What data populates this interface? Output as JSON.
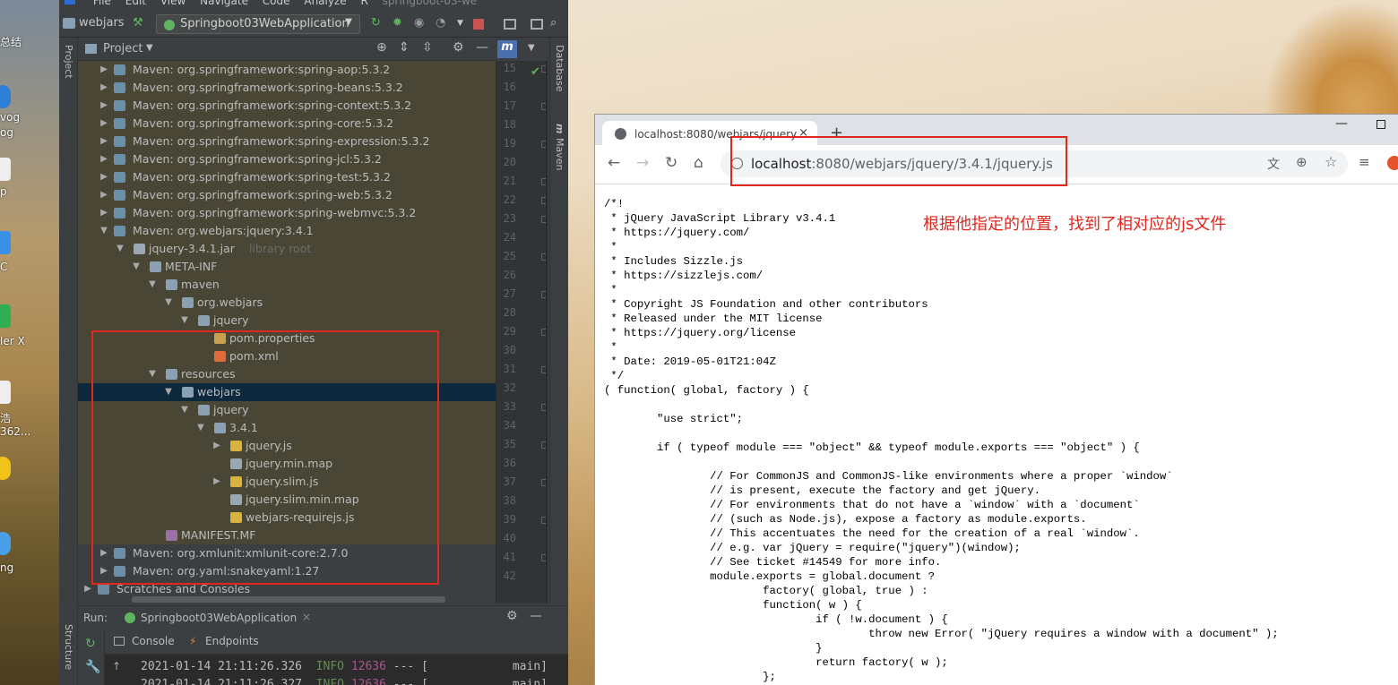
{
  "desktop": {
    "labels": [
      "总结",
      "vog",
      "og",
      "p",
      "C",
      "ler X",
      "浩",
      "362...",
      "ng"
    ]
  },
  "ide": {
    "menu": [
      "File",
      "Edit",
      "View",
      "Navigate",
      "Code",
      "Analyze",
      "R"
    ],
    "window_title": "springboot-03-we",
    "project_name": "webjars",
    "run_config": "Springboot03WebApplication",
    "left_tab": "Project",
    "bottom_left_tab": "Structure",
    "right_tabs": [
      "Database",
      "Maven"
    ],
    "project_panel_title": "Project",
    "tree": [
      {
        "label": "Maven: org.springframework:spring-aop:5.3.2"
      },
      {
        "label": "Maven: org.springframework:spring-beans:5.3.2"
      },
      {
        "label": "Maven: org.springframework:spring-context:5.3.2"
      },
      {
        "label": "Maven: org.springframework:spring-core:5.3.2"
      },
      {
        "label": "Maven: org.springframework:spring-expression:5.3.2"
      },
      {
        "label": "Maven: org.springframework:spring-jcl:5.3.2"
      },
      {
        "label": "Maven: org.springframework:spring-test:5.3.2"
      },
      {
        "label": "Maven: org.springframework:spring-web:5.3.2"
      },
      {
        "label": "Maven: org.springframework:spring-webmvc:5.3.2"
      },
      {
        "label": "Maven: org.webjars:jquery:3.4.1"
      },
      {
        "label": "jquery-3.4.1.jar",
        "suffix": "library root"
      },
      {
        "label": "META-INF"
      },
      {
        "label": "maven"
      },
      {
        "label": "org.webjars"
      },
      {
        "label": "jquery"
      },
      {
        "label": "pom.properties"
      },
      {
        "label": "pom.xml"
      },
      {
        "label": "resources"
      },
      {
        "label": "webjars"
      },
      {
        "label": "jquery"
      },
      {
        "label": "3.4.1"
      },
      {
        "label": "jquery.js"
      },
      {
        "label": "jquery.min.map"
      },
      {
        "label": "jquery.slim.js"
      },
      {
        "label": "jquery.slim.min.map"
      },
      {
        "label": "webjars-requirejs.js"
      },
      {
        "label": "MANIFEST.MF"
      },
      {
        "label": "Maven: org.xmlunit:xmlunit-core:2.7.0"
      },
      {
        "label": "Maven: org.yaml:snakeyaml:1.27"
      },
      {
        "label": "Scratches and Consoles"
      }
    ],
    "line_numbers": [
      "15",
      "16",
      "17",
      "18",
      "19",
      "20",
      "21",
      "22",
      "23",
      "24",
      "25",
      "26",
      "27",
      "28",
      "29",
      "30",
      "31",
      "32",
      "33",
      "34",
      "35",
      "36",
      "37",
      "38",
      "39",
      "40",
      "41",
      "42"
    ],
    "run": {
      "label": "Run:",
      "tab": "Springboot03WebApplication",
      "console_tab": "Console",
      "endpoints_tab": "Endpoints",
      "log": [
        {
          "ts": "2021-01-14 21:11:26.326",
          "level": "INFO",
          "pid": "12636",
          "sep": "--- [",
          "thread": "main]"
        },
        {
          "ts": "2021-01-14 21:11:26.327",
          "level": "INFO",
          "pid": "12636",
          "sep": "--- [",
          "thread": "main]"
        }
      ]
    }
  },
  "browser": {
    "tab_title": "localhost:8080/webjars/jquery",
    "new_tab": "+",
    "url_host": "localhost",
    "url_path": ":8080/webjars/jquery/3.4.1/jquery.js",
    "source_lines": [
      "/*!",
      " * jQuery JavaScript Library v3.4.1",
      " * https://jquery.com/",
      " *",
      " * Includes Sizzle.js",
      " * https://sizzlejs.com/",
      " *",
      " * Copyright JS Foundation and other contributors",
      " * Released under the MIT license",
      " * https://jquery.org/license",
      " *",
      " * Date: 2019-05-01T21:04Z",
      " */",
      "( function( global, factory ) {",
      "",
      "\t\"use strict\";",
      "",
      "\tif ( typeof module === \"object\" && typeof module.exports === \"object\" ) {",
      "",
      "\t\t// For CommonJS and CommonJS-like environments where a proper `window`",
      "\t\t// is present, execute the factory and get jQuery.",
      "\t\t// For environments that do not have a `window` with a `document`",
      "\t\t// (such as Node.js), expose a factory as module.exports.",
      "\t\t// This accentuates the need for the creation of a real `window`.",
      "\t\t// e.g. var jQuery = require(\"jquery\")(window);",
      "\t\t// See ticket #14549 for more info.",
      "\t\tmodule.exports = global.document ?",
      "\t\t\tfactory( global, true ) :",
      "\t\t\tfunction( w ) {",
      "\t\t\t\tif ( !w.document ) {",
      "\t\t\t\t\tthrow new Error( \"jQuery requires a window with a document\" );",
      "\t\t\t\t}",
      "\t\t\t\treturn factory( w );",
      "\t\t\t};"
    ]
  },
  "annotation": "根据他指定的位置，找到了相对应的js文件",
  "colors": {
    "annotation": "#e0281f",
    "selected_row": "#0d293e",
    "library_row": "#4a4636"
  }
}
